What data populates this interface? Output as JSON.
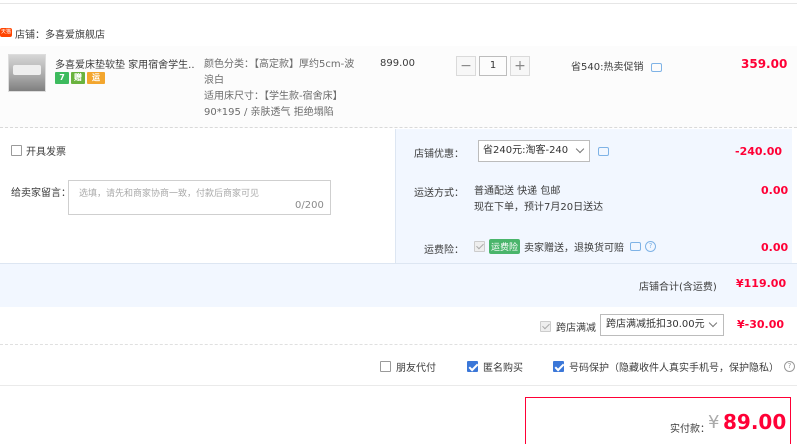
{
  "shop": {
    "badge": "天猫",
    "label": "店铺：多喜爱旗舰店"
  },
  "item": {
    "title": "多喜爱床垫软垫 家用宿舍学生...",
    "sku_color": "颜色分类：【高定款】厚约5cm-波浪白",
    "sku_size": "适用床尺寸：【学生款-宿舍床】90*195 / 亲肤透气 拒绝塌陷",
    "price": "899.00",
    "qty": "1",
    "qty_minus": "−",
    "qty_plus": "+",
    "promo": "省540:热卖促销",
    "total": "359.00",
    "service_icons": [
      "7",
      "赠",
      "运"
    ]
  },
  "invoice": {
    "label": "开具发票"
  },
  "message": {
    "label": "给卖家留言：",
    "placeholder": "选填，请先和商家协商一致，付款后商家可见",
    "count": "0/200"
  },
  "shop_discount": {
    "label": "店铺优惠：",
    "selected": "省240元:淘客-240",
    "amount": "-240.00"
  },
  "shipping": {
    "label": "运送方式：",
    "line1": "普通配送 快递 包邮",
    "line2": "现在下单，预计7月20日送达",
    "amount": "0.00"
  },
  "insurance": {
    "label": "运费险：",
    "tag": "运费险",
    "text": "卖家赠送，退换货可赔",
    "amount": "0.00"
  },
  "shop_total": {
    "label": "店铺合计(含运费)",
    "amount": "¥119.00"
  },
  "cross_store": {
    "label": "跨店满减",
    "selected": "跨店满减抵扣30.00元",
    "amount": "¥-30.00"
  },
  "options": {
    "friend_pay": "朋友代付",
    "anonymous": "匿名购买",
    "number_protect": "号码保护（隐藏收件人真实手机号，保护隐私）",
    "help": "?"
  },
  "payment": {
    "label": "实付款：",
    "currency": "¥",
    "amount": "89.00"
  },
  "colors": {
    "accent_red": "#ff0036",
    "brand_blue": "#3b77d8",
    "panel_blue": "#f2f7ff"
  }
}
